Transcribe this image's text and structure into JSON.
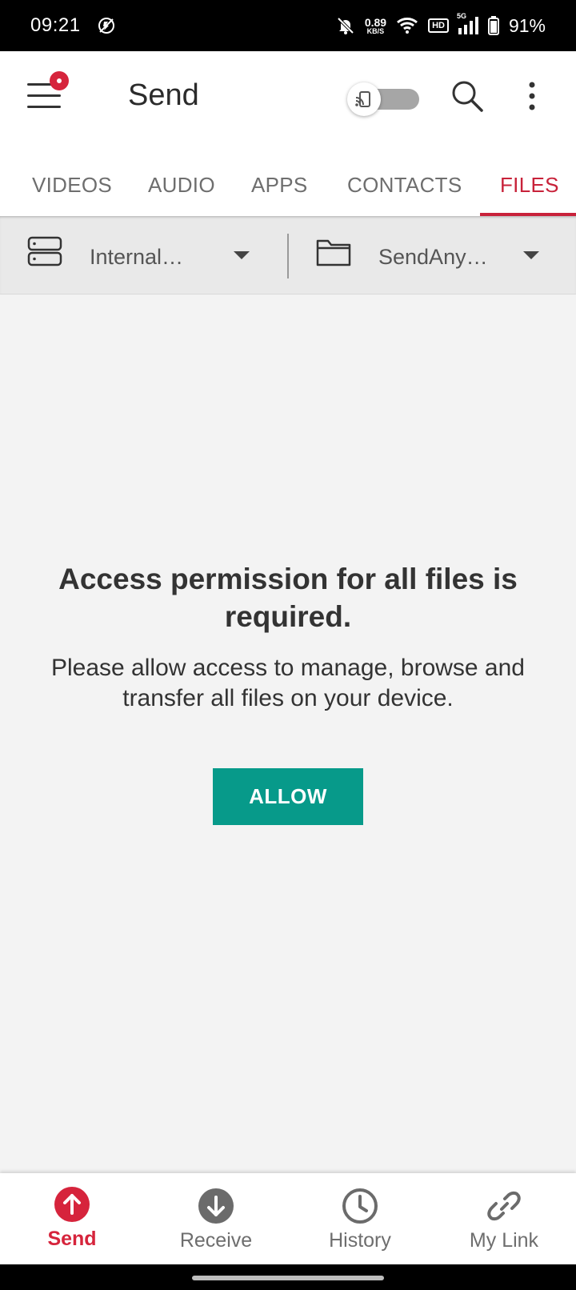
{
  "status_bar": {
    "time": "09:21",
    "speed_value": "0.89",
    "speed_unit": "KB/S",
    "hd_label": "HD",
    "network_label": "5G",
    "battery": "91%"
  },
  "header": {
    "title": "Send",
    "accent_color": "#d6243c"
  },
  "tabs": [
    {
      "label": "VIDEOS"
    },
    {
      "label": "AUDIO"
    },
    {
      "label": "APPS"
    },
    {
      "label": "CONTACTS"
    },
    {
      "label": "FILES",
      "active": true
    }
  ],
  "toolbar": {
    "storage_label": "Internal…",
    "folder_label": "SendAny…"
  },
  "permission": {
    "title": "Access permission for all files is required.",
    "body": "Please allow access to manage, browse and transfer all files on your device.",
    "button_label": "ALLOW",
    "button_color": "#079a8a"
  },
  "bottom_nav": [
    {
      "label": "Send",
      "icon": "upload-arrow-icon",
      "active": true
    },
    {
      "label": "Receive",
      "icon": "download-arrow-icon"
    },
    {
      "label": "History",
      "icon": "clock-icon"
    },
    {
      "label": "My Link",
      "icon": "link-icon"
    }
  ]
}
